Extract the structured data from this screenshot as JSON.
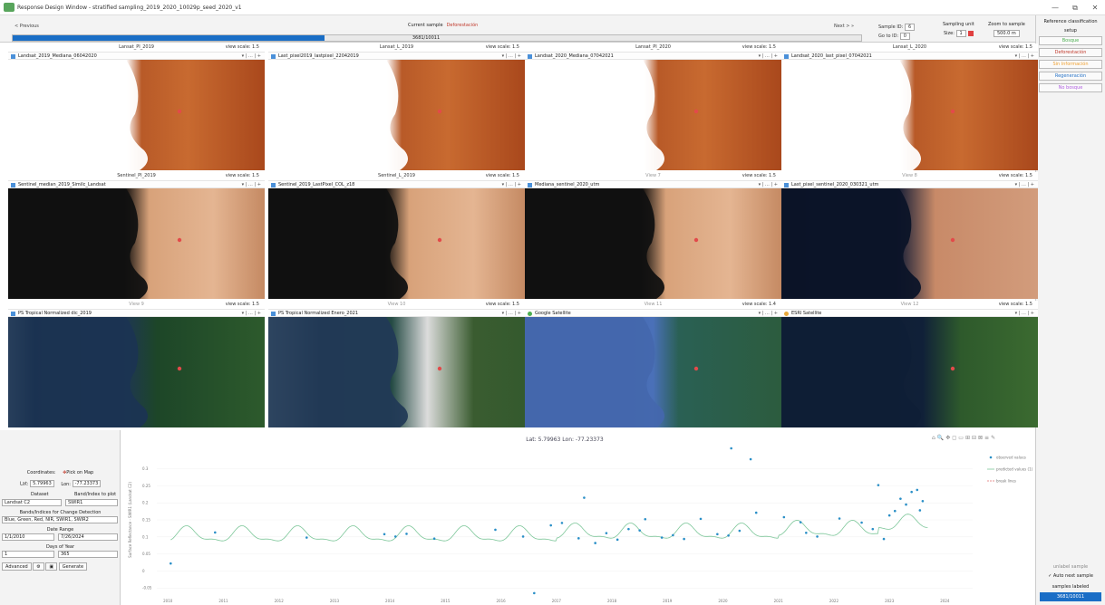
{
  "window": {
    "title": "Response Design Window - stratified sampling_2019_2020_10029p_seed_2020_v1",
    "controls": [
      "—",
      "⧉",
      "✕"
    ]
  },
  "nav": {
    "prev_label": "< Previous",
    "current_label": "Current sample",
    "current_class": "Deforestación",
    "next_label": "Next > »",
    "progress_count": "3681/10011",
    "progress_fraction": 0.3677,
    "sample_id_label": "Sample ID:",
    "sample_id_value": "6",
    "go_to_id_label": "Go to ID:",
    "go_to_id_value": "0",
    "sampling_unit_label": "Sampling unit",
    "size_label": "Size:",
    "size_value": "1",
    "zoom_label": "Zoom to sample",
    "zoom_value": "500.0 m"
  },
  "right_panel": {
    "title": "Reference classification",
    "setup_label": "setup",
    "labels": [
      {
        "text": "Bosque",
        "color": "#4caf50"
      },
      {
        "text": "Deforestación",
        "color": "#c0392b"
      },
      {
        "text": "Sin Información",
        "color": "#f0a030"
      },
      {
        "text": "Regeneración",
        "color": "#2874c8"
      },
      {
        "text": "No bosque",
        "color": "#b060e0"
      }
    ],
    "unlabel_label": "unlabel sample",
    "auto_next_label": "Auto next sample",
    "samples_labeled_label": "samples labeled",
    "samples_labeled_count": "3681/10011"
  },
  "views": [
    {
      "title": "Lansat_PI_2019",
      "scale": "view scale: 1.5",
      "layer": "Landsat_2019_Mediana_06042020",
      "img": "land"
    },
    {
      "title": "Lansat_L_2019",
      "scale": "view scale: 1.5",
      "layer": "Last_pixel2019_lastpixel_22042019",
      "img": "land"
    },
    {
      "title": "Lansat_PI_2020",
      "scale": "view scale: 1.5",
      "layer": "Landsat_2020_Mediana_07042021",
      "img": "land"
    },
    {
      "title": "Lansat_L_2020",
      "scale": "view scale: 1.5",
      "layer": "Landsat_2020_last_pixel_07042021",
      "img": "land"
    },
    {
      "title": "Sentinel_PI_2019",
      "scale": "view scale: 1.5",
      "layer": "Sentinel_median_2019_Similc_Landsat",
      "img": "sent"
    },
    {
      "title": "Sentinel_L_2019",
      "scale": "view scale: 1.5",
      "layer": "Sentinel_2019_LastPixel_COL_z18",
      "img": "sent"
    },
    {
      "title": "View 7",
      "scale": "view scale: 1.5",
      "layer": "Mediana_sentinel_2020_utm",
      "img": "sent",
      "grey": true
    },
    {
      "title": "View 8",
      "scale": "view scale: 1.5",
      "layer": "Last_pixel_sentinel_2020_030321_utm",
      "img": "sentblue",
      "grey": true
    },
    {
      "title": "View 9",
      "scale": "view scale: 1.5",
      "layer": "PS Tropical Normalized dic_2019",
      "img": "ps",
      "grey": true
    },
    {
      "title": "View 10",
      "scale": "view scale: 1.5",
      "layer": "PS Tropical Normalized Enero_2021",
      "img": "pscloud",
      "grey": true
    },
    {
      "title": "View 11",
      "scale": "view scale: 1.4",
      "layer": "Google Satellite",
      "img": "google",
      "grey": true,
      "icon": "google"
    },
    {
      "title": "View 12",
      "scale": "view scale: 1.5",
      "layer": "ESRI Satellite",
      "img": "esri",
      "grey": true,
      "icon": "esri"
    }
  ],
  "controls": {
    "coords_label": "Coordinates:",
    "pick_on_map": "Pick on Map",
    "lat_label": "Lat:",
    "lat_value": "5.79963",
    "lon_label": "Lon:",
    "lon_value": "-77.23373",
    "dataset_label": "Dataset",
    "dataset_value": "Landsat C2",
    "band_label": "Band/Index to plot",
    "band_value": "SWIR1",
    "bands_cd_label": "Bands/Indices for Change Detection",
    "bands_cd_value": "Blue, Green, Red, NIR, SWIR1, SWIR2",
    "date_range_label": "Date Range",
    "date_start": "1/1/2010",
    "date_end": "7/26/2024",
    "doy_label": "Days of Year",
    "doy_start": "1",
    "doy_end": "365",
    "advanced_label": "Advanced",
    "generate_label": "Generate"
  },
  "chart_data": {
    "type": "scatter",
    "title": "Lat: 5.79963 Lon: -77.23373",
    "ylabel": "Surface Reflectance - SWIR1 (Landsat C2)",
    "xlabel": "",
    "x_ticks": [
      "2010",
      "2011",
      "2012",
      "2013",
      "2014",
      "2015",
      "2016",
      "2017",
      "2018",
      "2019",
      "2020",
      "2021",
      "2022",
      "2023",
      "2024"
    ],
    "y_ticks": [
      "-0.05",
      "0",
      "0.05",
      "0.1",
      "0.15",
      "0.2",
      "0.25",
      "0.3"
    ],
    "ylim": [
      -0.06,
      0.36
    ],
    "xlim": [
      2009.8,
      2024.5
    ],
    "legend": [
      "observed values",
      "predicted values (1)",
      "break lines"
    ],
    "legend_position": "top-right",
    "observed": [
      [
        2010.05,
        0.022
      ],
      [
        2010.85,
        0.113
      ],
      [
        2012.5,
        0.098
      ],
      [
        2013.9,
        0.108
      ],
      [
        2014.1,
        0.101
      ],
      [
        2014.3,
        0.109
      ],
      [
        2014.8,
        0.095
      ],
      [
        2015.9,
        0.121
      ],
      [
        2016.4,
        0.101
      ],
      [
        2016.6,
        -0.065
      ],
      [
        2016.9,
        0.134
      ],
      [
        2017.1,
        0.141
      ],
      [
        2017.4,
        0.096
      ],
      [
        2017.5,
        0.215
      ],
      [
        2017.7,
        0.082
      ],
      [
        2017.9,
        0.111
      ],
      [
        2018.1,
        0.092
      ],
      [
        2018.3,
        0.123
      ],
      [
        2018.5,
        0.119
      ],
      [
        2018.6,
        0.152
      ],
      [
        2018.9,
        0.098
      ],
      [
        2019.1,
        0.105
      ],
      [
        2019.3,
        0.094
      ],
      [
        2019.6,
        0.153
      ],
      [
        2019.9,
        0.108
      ],
      [
        2020.1,
        0.104
      ],
      [
        2020.15,
        0.36
      ],
      [
        2020.3,
        0.118
      ],
      [
        2020.5,
        0.328
      ],
      [
        2020.6,
        0.171
      ],
      [
        2021.1,
        0.158
      ],
      [
        2021.4,
        0.143
      ],
      [
        2021.5,
        0.112
      ],
      [
        2021.7,
        0.101
      ],
      [
        2022.1,
        0.154
      ],
      [
        2022.5,
        0.142
      ],
      [
        2022.7,
        0.123
      ],
      [
        2022.8,
        0.252
      ],
      [
        2022.9,
        0.094
      ],
      [
        2023.0,
        0.163
      ],
      [
        2023.1,
        0.176
      ],
      [
        2023.2,
        0.212
      ],
      [
        2023.3,
        0.195
      ],
      [
        2023.4,
        0.232
      ],
      [
        2023.5,
        0.238
      ],
      [
        2023.55,
        0.178
      ],
      [
        2023.6,
        0.205
      ]
    ]
  }
}
